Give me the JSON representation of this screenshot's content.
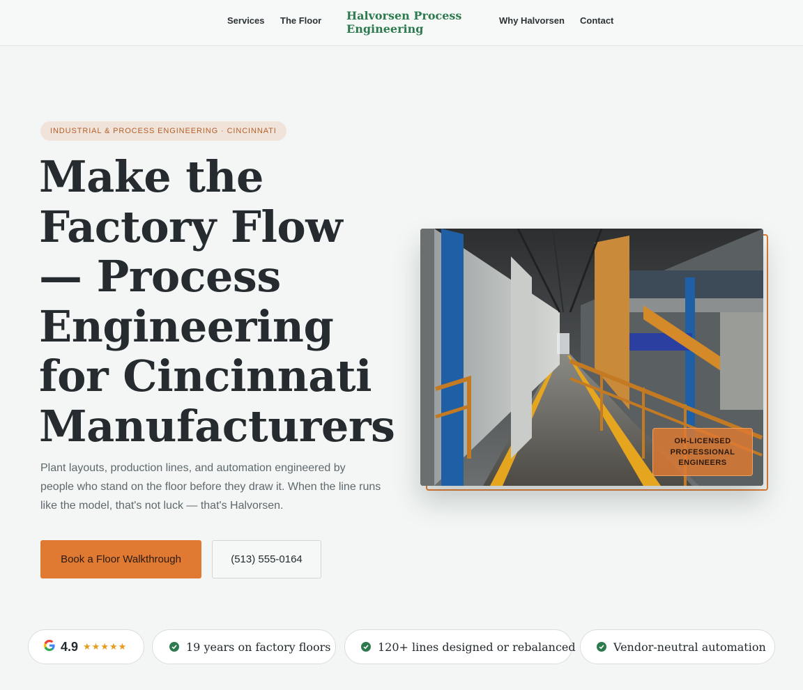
{
  "nav": {
    "left": [
      "Services",
      "The Floor"
    ],
    "brand": "Halvorsen Process Engineering",
    "right": [
      "Why Halvorsen",
      "Contact"
    ]
  },
  "hero": {
    "eyebrow": "INDUSTRIAL & PROCESS ENGINEERING · CINCINNATI",
    "title": "Make the Factory Flow — Process Engineering for Cincinnati Manufacturers",
    "lead": "Plant layouts, production lines, and automation engineered by people who stand on the floor before they draw it. When the line runs like the model, that's not luck — that's Halvorsen.",
    "cta_primary": "Book a Floor Walkthrough",
    "cta_phone": "(513) 555-0164",
    "badge": "OH-LICENSED PROFESSIONAL ENGINEERS"
  },
  "trust": {
    "rating": "4.9",
    "stars": "★★★★★",
    "items": [
      "19 years on factory floors",
      "120+ lines designed or rebalanced",
      "Vendor-neutral automation"
    ]
  },
  "colors": {
    "accent": "#e07a32",
    "brand": "#2c7a4e",
    "background": "#f3f6f5",
    "star": "#e79a1c"
  },
  "icons": {
    "rating": "google-g-icon",
    "trust": "check-circle-icon"
  }
}
